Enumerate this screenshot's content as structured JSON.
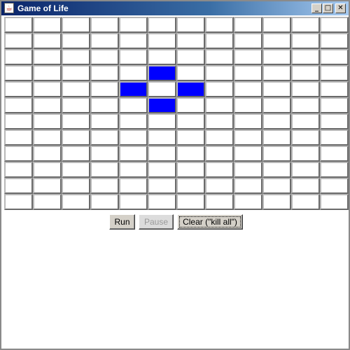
{
  "window": {
    "title": "Game of Life",
    "app_icon": "java-cup-icon",
    "minimize_glyph": "_",
    "maximize_glyph": "□",
    "close_glyph": "✕"
  },
  "grid": {
    "rows": 12,
    "cols": 12,
    "alive_color": "#0000ff",
    "dead_color": "#ffffff",
    "alive_cells": [
      [
        3,
        5
      ],
      [
        4,
        4
      ],
      [
        4,
        6
      ],
      [
        5,
        5
      ]
    ]
  },
  "controls": {
    "run_label": "Run",
    "pause_label": "Pause",
    "clear_label": "Clear (\"kill all\")"
  }
}
